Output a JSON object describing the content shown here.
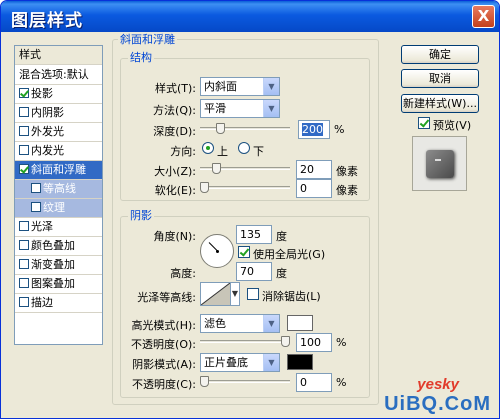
{
  "window": {
    "title": "图层样式",
    "close_label": "X"
  },
  "styles_list": {
    "header": "样式",
    "items": [
      {
        "label": "混合选项:默认",
        "checkbox": false,
        "checked": false,
        "state": "normal"
      },
      {
        "label": "投影",
        "checkbox": true,
        "checked": true,
        "state": "normal"
      },
      {
        "label": "内阴影",
        "checkbox": true,
        "checked": false,
        "state": "normal"
      },
      {
        "label": "外发光",
        "checkbox": true,
        "checked": false,
        "state": "normal"
      },
      {
        "label": "内发光",
        "checkbox": true,
        "checked": false,
        "state": "normal"
      },
      {
        "label": "斜面和浮雕",
        "checkbox": true,
        "checked": true,
        "state": "selected"
      },
      {
        "label": "等高线",
        "checkbox": true,
        "checked": false,
        "state": "sub"
      },
      {
        "label": "纹理",
        "checkbox": true,
        "checked": false,
        "state": "sub"
      },
      {
        "label": "光泽",
        "checkbox": true,
        "checked": false,
        "state": "normal"
      },
      {
        "label": "颜色叠加",
        "checkbox": true,
        "checked": false,
        "state": "normal"
      },
      {
        "label": "渐变叠加",
        "checkbox": true,
        "checked": false,
        "state": "normal"
      },
      {
        "label": "图案叠加",
        "checkbox": true,
        "checked": false,
        "state": "normal"
      },
      {
        "label": "描边",
        "checkbox": true,
        "checked": false,
        "state": "normal"
      }
    ]
  },
  "bevel": {
    "group_title": "斜面和浮雕",
    "structure": {
      "title": "结构",
      "style_label": "样式(T):",
      "style_value": "内斜面",
      "technique_label": "方法(Q):",
      "technique_value": "平滑",
      "depth_label": "深度(D):",
      "depth_value": "200",
      "depth_unit": "%",
      "depth_slider": 0.2,
      "direction_label": "方向:",
      "direction_up": "上",
      "direction_down": "下",
      "size_label": "大小(Z):",
      "size_value": "20",
      "size_unit": "像素",
      "size_slider": 0.15,
      "soften_label": "软化(E):",
      "soften_value": "0",
      "soften_unit": "像素",
      "soften_slider": 0.0
    },
    "shading": {
      "title": "阴影",
      "angle_label": "角度(N):",
      "angle_value": "135",
      "angle_unit": "度",
      "global_light_label": "使用全局光(G)",
      "altitude_label": "高度:",
      "altitude_value": "70",
      "altitude_unit": "度",
      "gloss_contour_label": "光泽等高线:",
      "anti_alias_label": "消除锯齿(L)",
      "highlight_mode_label": "高光模式(H):",
      "highlight_mode_value": "滤色",
      "highlight_color": "#ffffff",
      "highlight_opacity_label": "不透明度(O):",
      "highlight_opacity_value": "100",
      "highlight_opacity_slider": 1.0,
      "shadow_mode_label": "阴影模式(A):",
      "shadow_mode_value": "正片叠底",
      "shadow_color": "#000000",
      "shadow_opacity_label": "不透明度(C):",
      "shadow_opacity_value": "0",
      "shadow_opacity_slider": 0.0,
      "percent_unit": "%"
    }
  },
  "buttons": {
    "ok": "确定",
    "cancel": "取消",
    "new_style": "新建样式(W)...",
    "preview_label": "预览(V)"
  },
  "watermark": {
    "main": "UiBQ.CoM",
    "small": "yesky"
  }
}
